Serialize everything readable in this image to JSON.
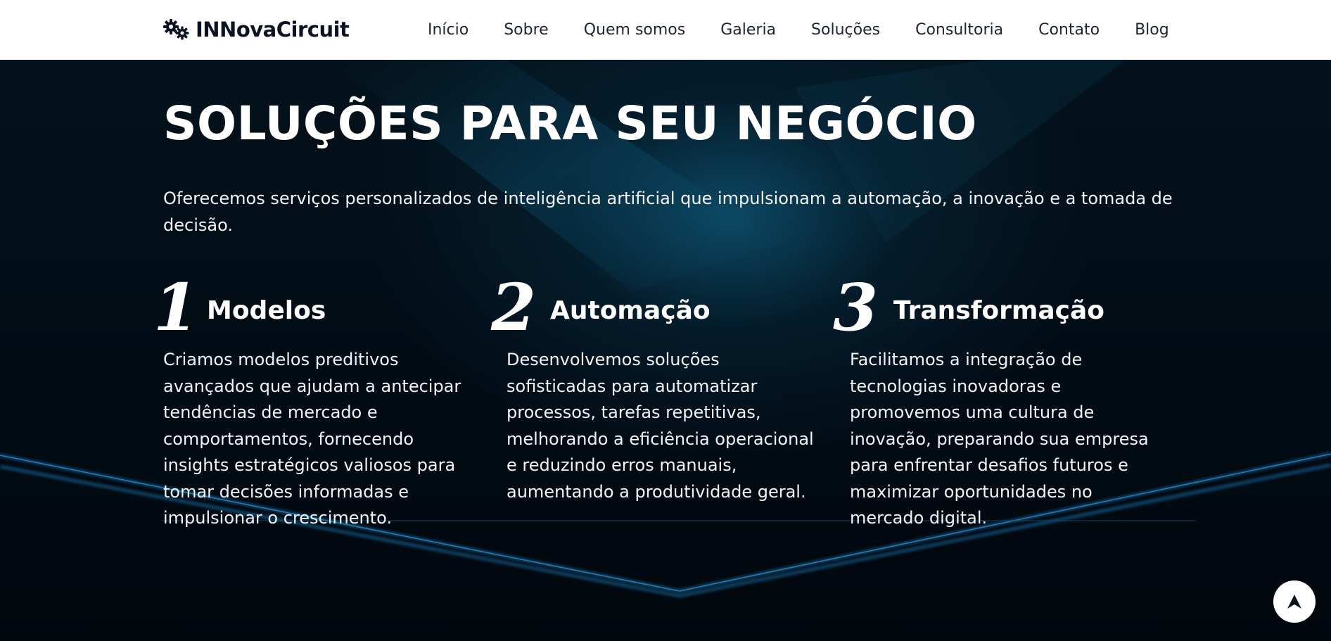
{
  "header": {
    "brand_name": "INNovaCircuit",
    "logo_icon": "gears-icon",
    "nav": [
      {
        "label": "Início"
      },
      {
        "label": "Sobre"
      },
      {
        "label": "Quem somos"
      },
      {
        "label": "Galeria"
      },
      {
        "label": "Soluções"
      },
      {
        "label": "Consultoria"
      },
      {
        "label": "Contato"
      },
      {
        "label": "Blog"
      }
    ]
  },
  "hero": {
    "title": "SOLUÇÕES PARA SEU NEGÓCIO",
    "description": "Oferecemos serviços personalizados de inteligência artificial que impulsionam a automação, a inovação e a tomada de decisão.",
    "features": [
      {
        "number": "1",
        "title": "Modelos",
        "text": "Criamos modelos preditivos avançados que ajudam a antecipar tendências de mercado e comportamentos, fornecendo insights estratégicos valiosos para tomar decisões informadas e impulsionar o crescimento."
      },
      {
        "number": "2",
        "title": "Automação",
        "text": "Desenvolvemos soluções sofisticadas para automatizar processos, tarefas repetitivas, melhorando a eficiência operacional e reduzindo erros manuais, aumentando a produtividade geral."
      },
      {
        "number": "3",
        "title": "Transformação",
        "text": "Facilitamos a integração de tecnologias inovadoras e promovemos uma cultura de inovação, preparando sua empresa para enfrentar desafios futuros e maximizar oportunidades no mercado digital."
      }
    ]
  },
  "scroll_top": {
    "icon": "arrow-up-icon"
  },
  "colors": {
    "header_bg": "#ffffff",
    "brand_text": "#0b1224",
    "hero_bg": "#020a12",
    "hero_glow": "#0e5270",
    "light_lines": "#1a6fa8",
    "text": "#ffffff"
  }
}
